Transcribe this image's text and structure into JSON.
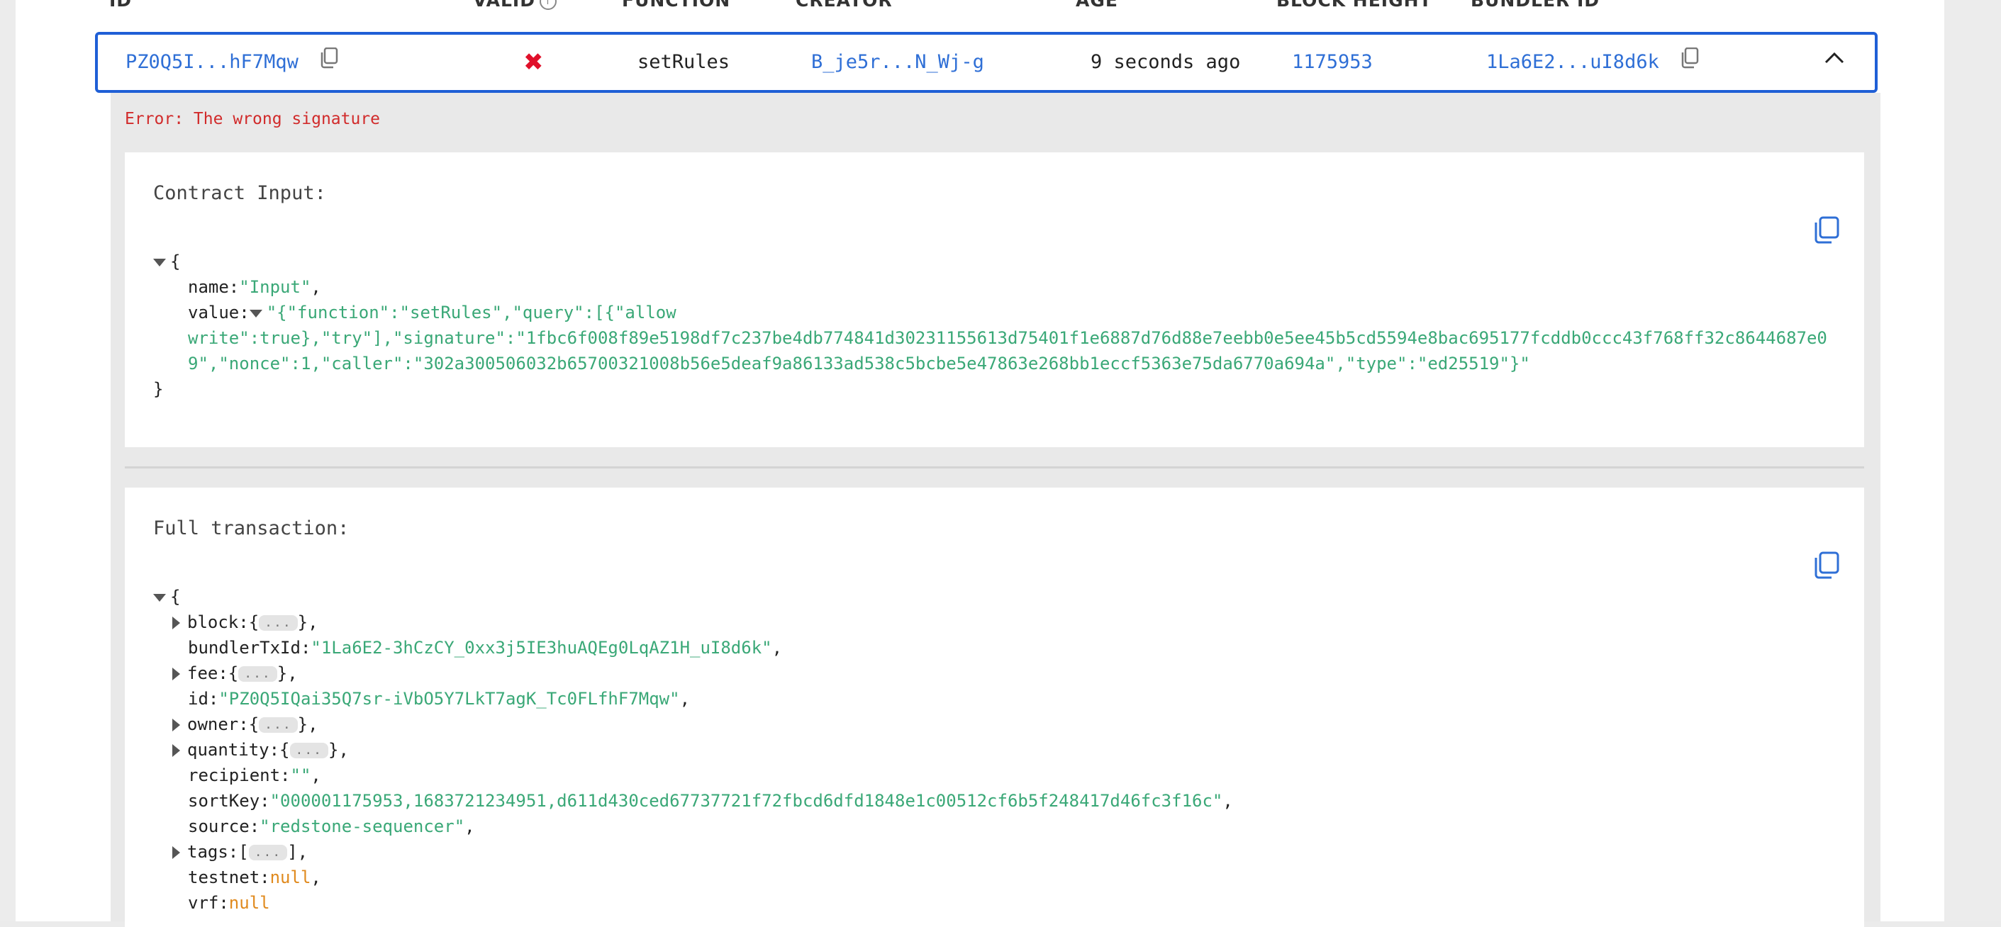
{
  "table": {
    "headers": {
      "id": "ID",
      "valid": "VALID",
      "function": "FUNCTION",
      "creator": "CREATOR",
      "age": "AGE",
      "block_height": "BLOCK HEIGHT",
      "bundler_id": "BUNDLER ID"
    },
    "row": {
      "id": "PZ0Q5I...hF7Mqw",
      "valid_icon": "cross-icon",
      "valid_symbol": "✖",
      "function": "setRules",
      "creator": "B_je5r...N_Wj-g",
      "age": "9 seconds ago",
      "block_height": "1175953",
      "bundler_id": "1La6E2...uI8d6k"
    }
  },
  "details": {
    "error": "Error: The wrong signature",
    "contract_input": {
      "title": "Contract Input:",
      "open_brace": "{",
      "close_brace": "}",
      "name_key": "name:",
      "name_value": "\"Input\"",
      "comma": ",",
      "value_key": "value:",
      "value_line1": "\"{\"function\":\"setRules\",\"query\":[{\"allow",
      "value_line2": "write\":true},\"try\"],\"signature\":\"1fbc6f008f89e5198df7c237be4db774841d30231155613d75401f1e6887d76d88e7eebb0e5ee45b5cd5594e8bac695177fcddb0ccc43f768ff32c8644687e0",
      "value_line3": "9\",\"nonce\":1,\"caller\":\"302a300506032b65700321008b56e5deaf9a86133ad538c5bcbe5e47863e268bb1eccf5363e75da6770a694a\",\"type\":\"ed25519\"}\""
    },
    "full_transaction": {
      "title": "Full transaction:",
      "open_brace": "{",
      "close_brace": "}",
      "collapsed": "...",
      "block_key": "block:",
      "bundlerTxId_key": "bundlerTxId:",
      "bundlerTxId_value": "\"1La6E2-3hCzCY_0xx3j5IE3huAQEg0LqAZ1H_uI8d6k\"",
      "fee_key": "fee:",
      "id_key": "id:",
      "id_value": "\"PZ0Q5IQai35Q7sr-iVbO5Y7LkT7agK_Tc0FLfhF7Mqw\"",
      "owner_key": "owner:",
      "quantity_key": "quantity:",
      "recipient_key": "recipient:",
      "recipient_value": "\"\"",
      "sortKey_key": "sortKey:",
      "sortKey_value": "\"000001175953,1683721234951,d611d430ced67737721f72fbcd6dfd1848e1c00512cf6b5f248417d46fc3f16c\"",
      "source_key": "source:",
      "source_value": "\"redstone-sequencer\"",
      "tags_key": "tags:",
      "testnet_key": "testnet:",
      "testnet_value": "null",
      "vrf_key": "vrf:",
      "vrf_value": "null"
    }
  },
  "colors": {
    "accent": "#1f5fd6",
    "link": "#2f6fd6",
    "error": "#d12b2b",
    "string": "#3aa877",
    "null": "#e08a1e"
  }
}
